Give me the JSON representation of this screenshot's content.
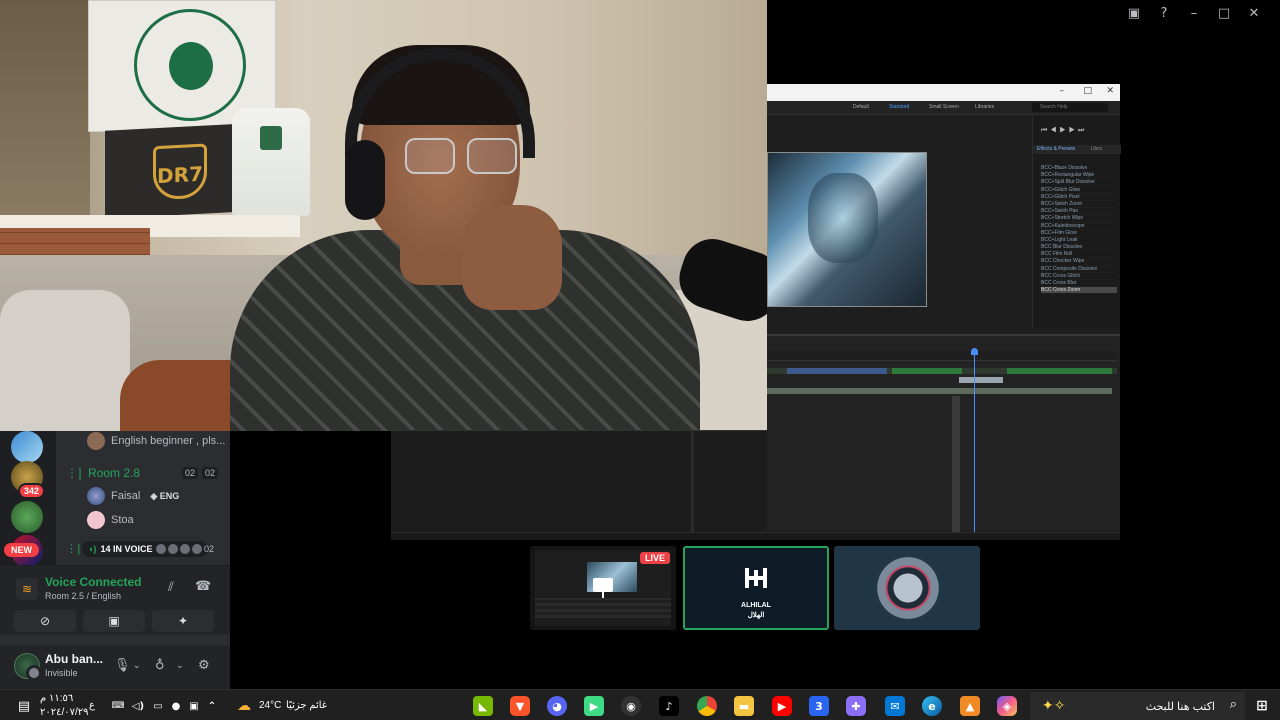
{
  "discord": {
    "channel_user_1": "English beginner , pls...",
    "room": {
      "name": "Room 2.8",
      "count_a": "02",
      "count_b": "02"
    },
    "room_users": [
      {
        "name": "Faisal",
        "tag": "ENG"
      },
      {
        "name": "Stoa"
      }
    ],
    "server_badge": "342",
    "new_badge": "NEW",
    "voice_pill": "14 IN VOICE",
    "voice_pill_suffix": "02",
    "voice_connected": {
      "title": "Voice Connected",
      "subtitle": "Room 2.5 / English"
    },
    "user": {
      "name": "Abu ban...",
      "status": "Invisible"
    }
  },
  "tiles": {
    "live_label": "LIVE",
    "hilal_top": "ALHILAL",
    "hilal_bottom": "الهلال"
  },
  "premiere": {
    "tabs": [
      "Default",
      "Standard",
      "Small Screen",
      "Libraries"
    ],
    "active_tab": "Standard",
    "search_placeholder": "Search Help",
    "effects_header": "Effects & Presets",
    "libraries_header": "Libra",
    "effects": [
      "BCC+Blaze Dissolve",
      "BCC+Rectangular Wipe",
      "BCC+Split Blur Dissolve",
      "BCC+Glitch Glow",
      "BCC+Glitch Pixel",
      "BCC+Swish Zoom",
      "BCC+Swish Pan",
      "BCC+Stretch Wipe",
      "BCC+Kaleidoscope",
      "BCC+Film Glow",
      "BCC+Light Leak",
      "BCC Blur Dissolve",
      "BCC Film Roll",
      "BCC Checker Wipe",
      "BCC Composite Dissolve",
      "BCC Cross Glitch",
      "BCC Cross Blur",
      "BCC Cross Zoom"
    ]
  },
  "taskbar": {
    "temperature": "24°C",
    "weather": "غائم جزئيًا",
    "time": "١١:٥٦ م",
    "date": "٢٠٢٤/٠٧/٢٩",
    "lang": "ع",
    "search_placeholder": "اكتب هنا للبحث"
  },
  "colors": {
    "discord_bg": "#2b2d31",
    "voice_green": "#23a55a",
    "live_red": "#ed4245",
    "premiere_blue": "#4b8df8"
  }
}
